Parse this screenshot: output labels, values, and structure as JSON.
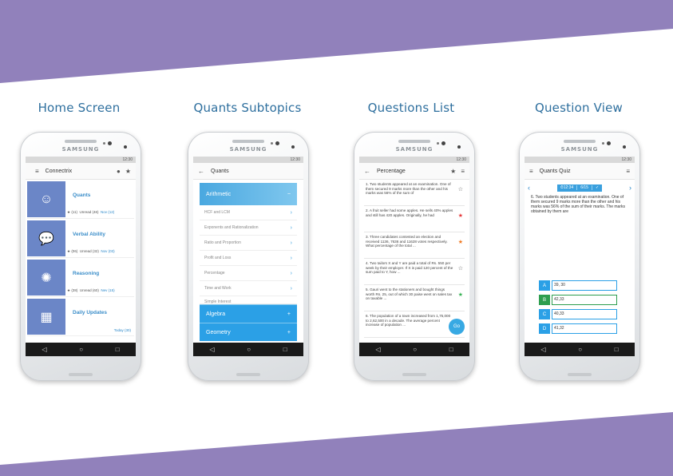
{
  "colors": {
    "band": "#9181bb",
    "title": "#2e6f9e",
    "accent": "#2ba0e6",
    "correct": "#2e9e4f",
    "star_red": "#e5393b",
    "star_orange": "#f07a24",
    "star_green": "#38b356"
  },
  "columns": [
    {
      "title": "Home Screen"
    },
    {
      "title": "Quants Subtopics"
    },
    {
      "title": "Questions List"
    },
    {
      "title": "Question View"
    }
  ],
  "brand": "SAMSUNG",
  "status_time": "12:30",
  "nav": {
    "back": "◁",
    "home": "○",
    "recent": "□"
  },
  "home": {
    "title": "Connectrix",
    "menu_icon": "menu-icon",
    "cards": [
      {
        "name": "Quants",
        "icon": "head-brain-icon",
        "stats_star": "★",
        "stats_count": "(11)",
        "unread": "Unread (46)",
        "new": "Nov (12)"
      },
      {
        "name": "Verbal Ability",
        "icon": "speech-person-icon",
        "stats_star": "★",
        "stats_count": "(06)",
        "unread": "Unread (32)",
        "new": "Nov (03)"
      },
      {
        "name": "Reasoning",
        "icon": "lightbulb-head-icon",
        "stats_star": "★",
        "stats_count": "(38)",
        "unread": "Unread (60)",
        "new": "Nev (15)"
      },
      {
        "name": "Daily Updates",
        "icon": "calendar-clock-icon",
        "stats_star": "",
        "stats_count": "",
        "unread": "",
        "new": "Today (30)"
      }
    ]
  },
  "quants": {
    "title": "Quants",
    "open_section": "Arithmetic",
    "subtopics": [
      "HCF and LCM",
      "Exponents and Rationalization",
      "Ratio and Proportion",
      "Profit and Loss",
      "Percentage",
      "Time and Work",
      "Simple Interest"
    ],
    "sections": [
      "Algebra",
      "Geometry"
    ]
  },
  "questions": {
    "title": "Percentage",
    "fab": "Go",
    "items": [
      {
        "text": "1. Two students appeared at an examination. One of them secured 9 marks more than the other and his marks was 56% of the sum of",
        "star": "☆",
        "star_color": "#555555"
      },
      {
        "text": "2. A fruit seller had some apples. He sells 40% apples and still has 420 apples. Originally, he had",
        "star": "★",
        "star_color": "#e5393b"
      },
      {
        "text": "3. Three candidates contested an election and received 1136, 7636 and 11628 votes respectively. What percentage of the total ...",
        "star": "★",
        "star_color": "#f07a24"
      },
      {
        "text": "4. Two tailors X and Y are paid a total of Rs. 550 per week by their employer. If X is paid 120 percent of the sum paid to Y, how ...",
        "star": "☆",
        "star_color": "#555555"
      },
      {
        "text": "5. Gauri went to the stationers and bought things worth Rs. 25, out of which 30 paise went on sales tax on taxable ...",
        "star": "★",
        "star_color": "#38b356"
      },
      {
        "text": "6. The population of a town increased from 1,75,000 to 2,62,500 in a decade. The average percent increase of population ...",
        "star": "",
        "star_color": "#555555"
      }
    ]
  },
  "quiz": {
    "title": "Quants Quiz",
    "timer": "⏱12:34",
    "progress": "6/15",
    "check": "✓",
    "question": "6. Two students appeared at an examination. One of them secured 9 marks more than the other and his marks was 56% of the sum of their marks. The marks obtained by them are",
    "options": [
      {
        "letter": "A",
        "value": "39, 30"
      },
      {
        "letter": "B",
        "value": "42,33"
      },
      {
        "letter": "C",
        "value": "40,33"
      },
      {
        "letter": "D",
        "value": "41,32"
      }
    ]
  }
}
